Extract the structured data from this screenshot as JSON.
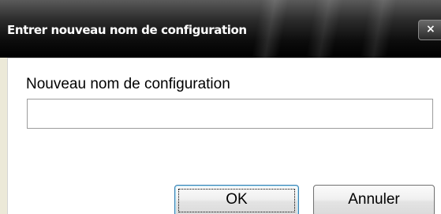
{
  "dialog": {
    "title": "Entrer nouveau nom de configuration",
    "close_symbol": "×",
    "field_label": "Nouveau nom de configuration",
    "field_value": "",
    "buttons": {
      "ok_label": "OK",
      "cancel_label": "Annuler"
    }
  },
  "icons": {
    "close": "close-icon"
  },
  "colors": {
    "titlebar": "#000000",
    "title_text": "#ffffff",
    "client_background": "#ffffff",
    "ok_button_border": "#3c7fb1",
    "cancel_button_border": "#707070"
  }
}
